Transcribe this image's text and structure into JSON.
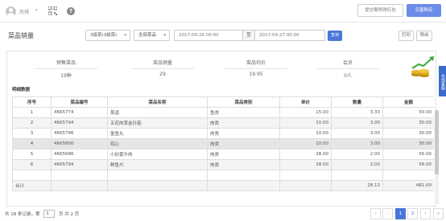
{
  "topbar": {
    "user": "热辣",
    "case_button": "提交案例得红包",
    "buy_button": "完善购买"
  },
  "filter": {
    "title": "菜品销量",
    "category_select": "3级菜(3级菜)",
    "subcategory_select": "全部菜品",
    "start_date": "2017-09-26 00:00",
    "to_label": "至",
    "end_date": "2017-09-27 00:00",
    "query_button": "查询",
    "print_button": "打印",
    "export_button": "导出"
  },
  "stats": [
    {
      "label": "销售菜品",
      "value": "19种"
    },
    {
      "label": "菜品销量",
      "value": "29"
    },
    {
      "label": "菜品均价",
      "value": "19.95"
    },
    {
      "label": "会员",
      "value": "0人"
    }
  ],
  "side_tab": "在线客服",
  "detail": {
    "title": "明细数据",
    "columns": [
      "序号",
      "菜品编号",
      "菜品名称",
      "菜品类别",
      "单价",
      "数量",
      "金额"
    ],
    "rows": [
      [
        "1",
        "4665774",
        "菜卤",
        "鱼类",
        "15.00",
        "3.33",
        "50.00"
      ],
      [
        "2",
        "4665794",
        "五花肉草金针菇",
        "肉类",
        "10.00",
        "3.00",
        "30.00"
      ],
      [
        "3",
        "4665796",
        "墨鱼丸",
        "肉类",
        "10.00",
        "3.00",
        "30.00"
      ],
      [
        "4",
        "4665800",
        "鸡心",
        "肉类",
        "10.00",
        "3.00",
        "30.00"
      ],
      [
        "5",
        "4665686",
        "小砂黄牛肉",
        "肉类",
        "28.00",
        "2.00",
        "56.00"
      ],
      [
        "6",
        "4665794",
        "鲜鱼爪",
        "肉类",
        "28.00",
        "2.00",
        "56.00"
      ]
    ],
    "total": {
      "label": "合计",
      "quantity": "28.12",
      "amount": "481.00"
    }
  },
  "pager": {
    "summary_prefix": "共 18 条记录，第",
    "current_page": "1",
    "summary_suffix": "页 共 2 页",
    "buttons": [
      "«",
      "‹",
      "1",
      "2",
      "›",
      "»"
    ],
    "active": "1"
  },
  "colors": {
    "accent": "#4a76d8",
    "buy": "#6b8ce8"
  }
}
